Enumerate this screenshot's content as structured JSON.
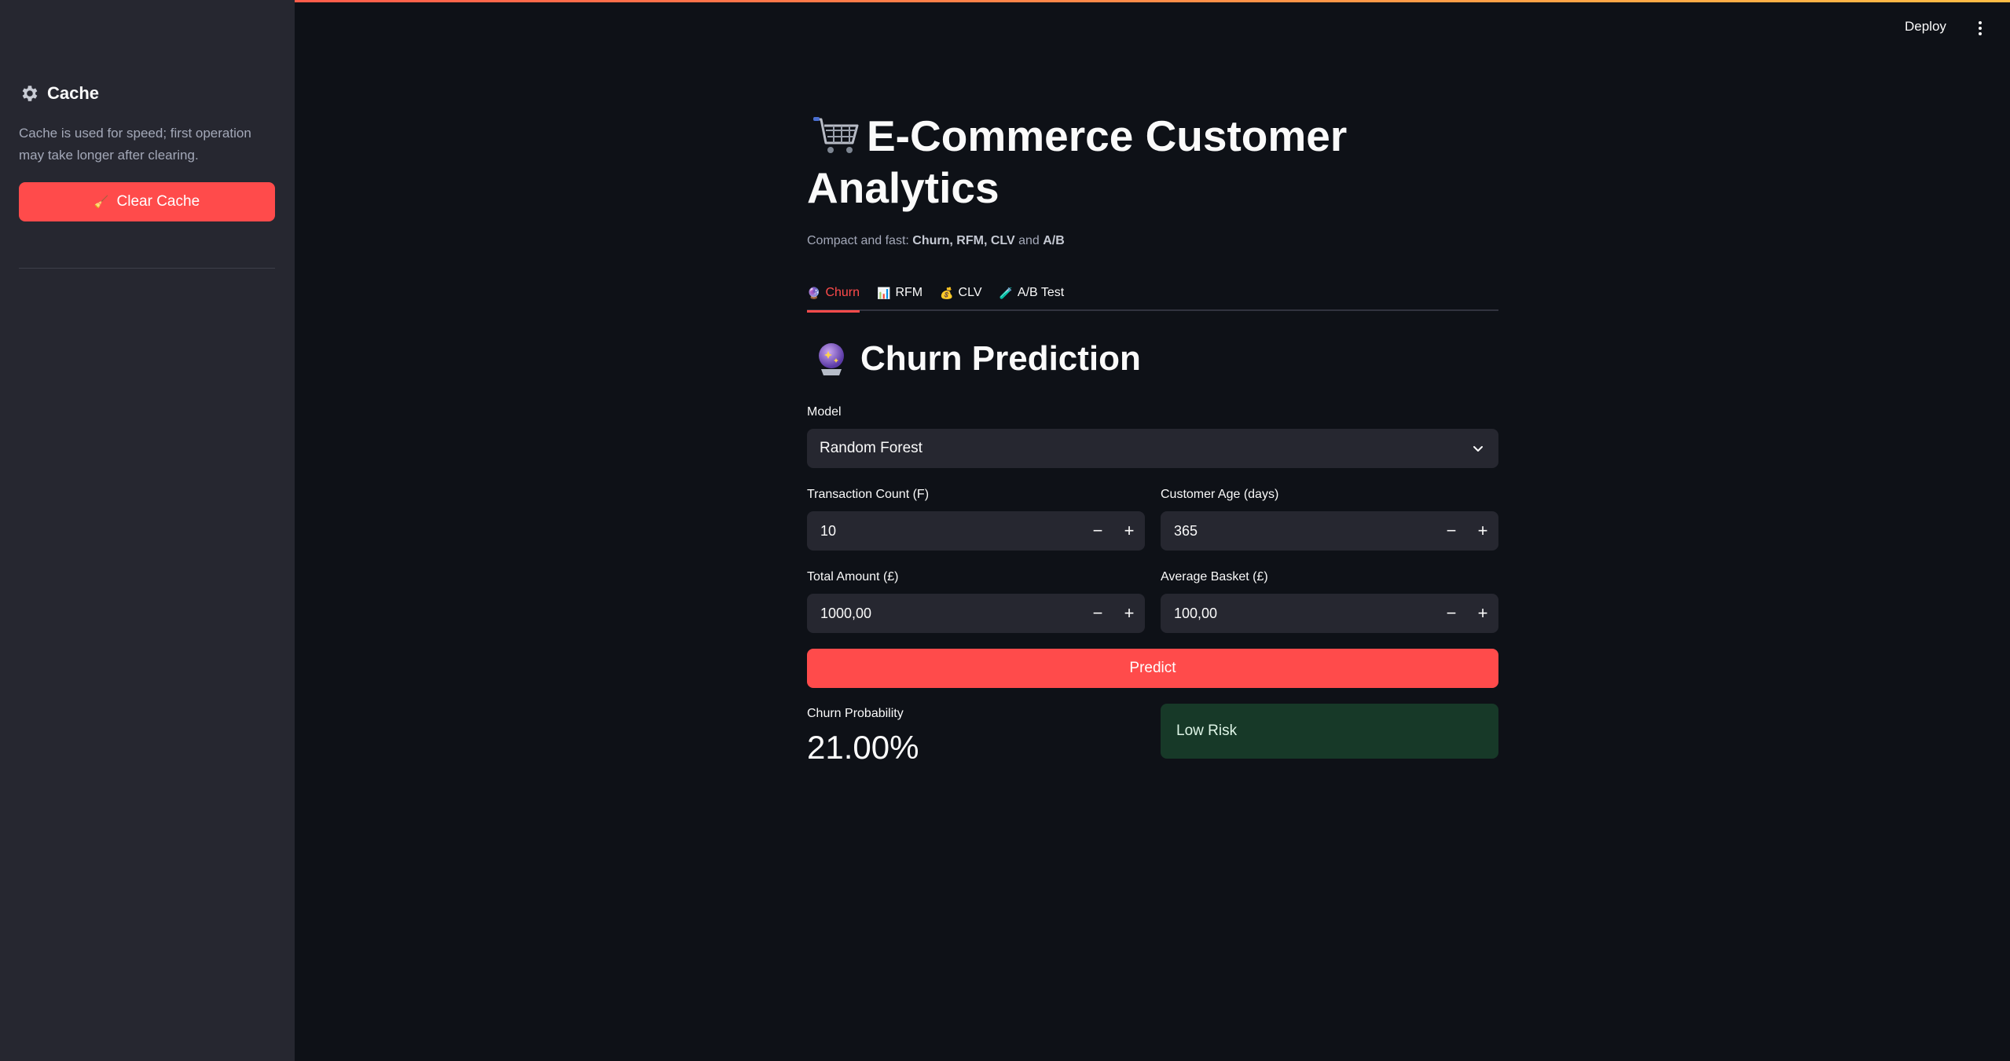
{
  "sidebar": {
    "title": "Cache",
    "title_icon": "gear-icon",
    "description": "Cache is used for speed; first operation may take longer after clearing.",
    "clear_button": "Clear Cache",
    "clear_button_icon": "broom-icon"
  },
  "header": {
    "deploy": "Deploy",
    "menu_icon": "kebab-menu-icon"
  },
  "main": {
    "title": "E-Commerce Customer Analytics",
    "title_icon": "shopping-cart-icon",
    "subtitle_prefix": "Compact and fast: ",
    "subtitle_churn": "Churn",
    "subtitle_sep1": ", ",
    "subtitle_rfm": "RFM",
    "subtitle_sep2": ", ",
    "subtitle_clv": "CLV",
    "subtitle_and": " and ",
    "subtitle_ab": "A/B",
    "tabs": [
      {
        "label": "Churn",
        "icon": "crystal-ball-icon",
        "active": true
      },
      {
        "label": "RFM",
        "icon": "bar-chart-icon",
        "active": false
      },
      {
        "label": "CLV",
        "icon": "money-bag-icon",
        "active": false
      },
      {
        "label": "A/B Test",
        "icon": "test-tube-icon",
        "active": false
      }
    ],
    "section_title": "Churn Prediction",
    "section_icon": "crystal-ball-icon",
    "model_label": "Model",
    "model_value": "Random Forest",
    "inputs": {
      "transaction_count_label": "Transaction Count (F)",
      "transaction_count_value": "10",
      "customer_age_label": "Customer Age (days)",
      "customer_age_value": "365",
      "total_amount_label": "Total Amount (£)",
      "total_amount_value": "1000,00",
      "avg_basket_label": "Average Basket (£)",
      "avg_basket_value": "100,00",
      "minus": "−",
      "plus": "+"
    },
    "predict_button": "Predict",
    "metric_label": "Churn Probability",
    "metric_value": "21.00%",
    "risk_text": "Low Risk"
  },
  "colors": {
    "background": "#0e1117",
    "sidebar": "#262730",
    "accent": "#ff4b4b",
    "success_bg": "#173928"
  }
}
